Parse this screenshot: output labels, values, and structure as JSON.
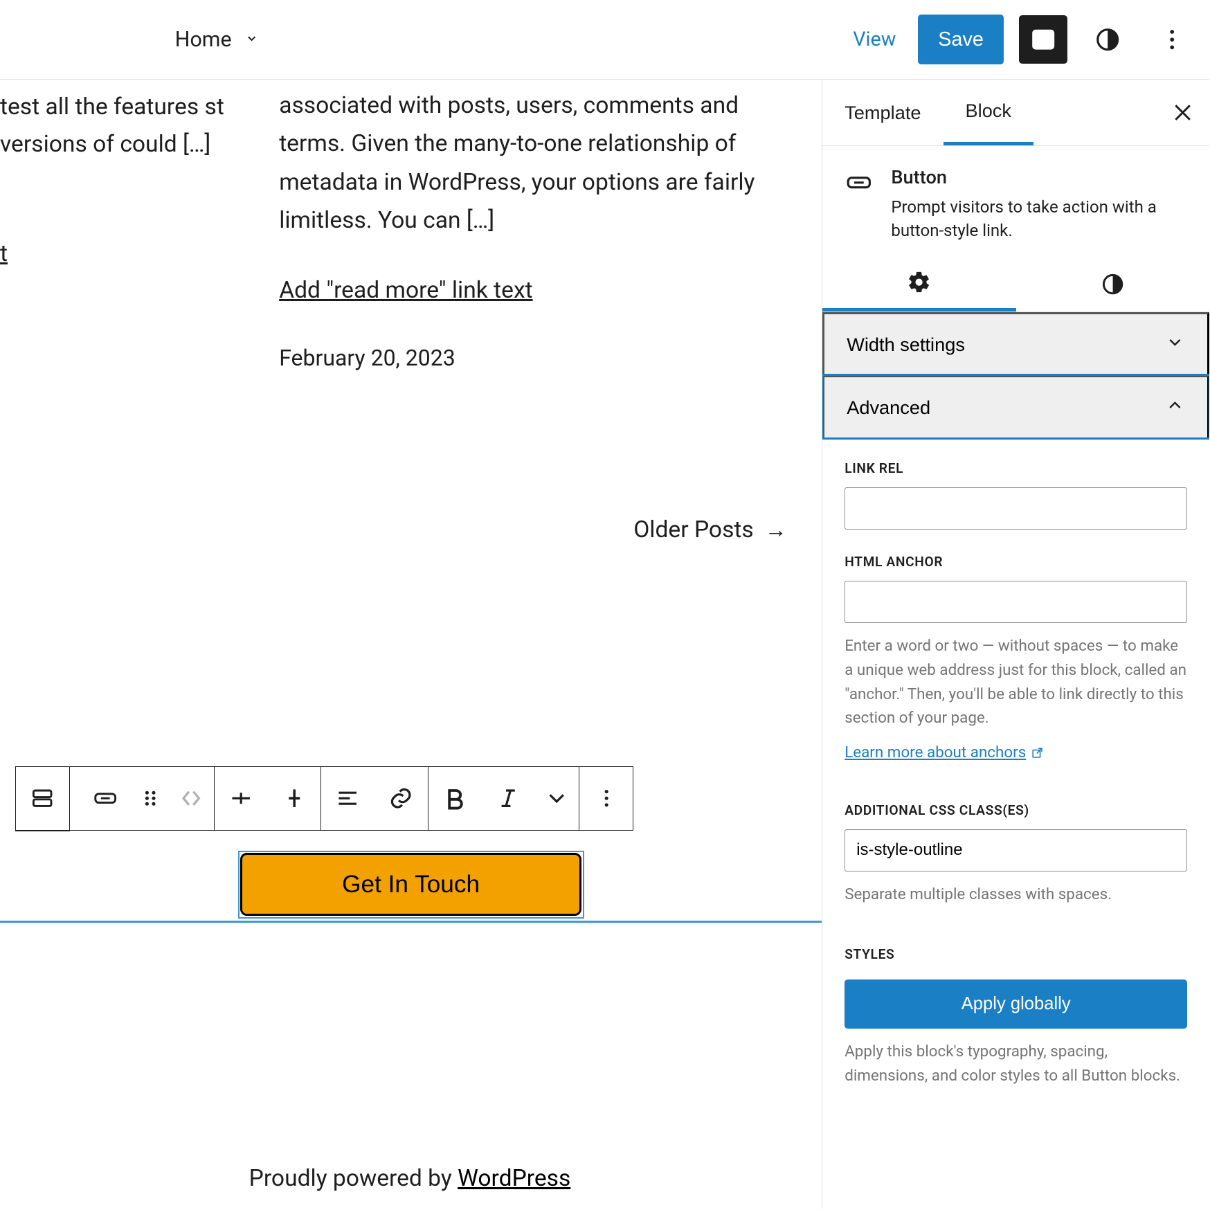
{
  "topbar": {
    "home": "Home",
    "view": "View",
    "save": "Save"
  },
  "canvas": {
    "excerpt_left": "test all the features st versions of could […]",
    "readmore_left": "t",
    "excerpt_right": "associated with posts, users, comments and terms. Given the many-to-one relationship of metadata in WordPress, your options are fairly limitless. You can […]",
    "readmore_right": "Add \"read more\" link text",
    "post_date": "February 20, 2023",
    "older_posts": "Older Posts",
    "button_label": "Get In Touch",
    "footer_prefix": "Proudly powered by ",
    "footer_link": "WordPress"
  },
  "sidebar": {
    "tabs": {
      "template": "Template",
      "block": "Block"
    },
    "block": {
      "name": "Button",
      "desc": "Prompt visitors to take action with a button-style link."
    },
    "panels": {
      "width": "Width settings",
      "advanced": "Advanced"
    },
    "fields": {
      "link_rel_label": "LINK REL",
      "link_rel_value": "",
      "anchor_label": "HTML ANCHOR",
      "anchor_value": "",
      "anchor_help": "Enter a word or two — without spaces — to make a unique web address just for this block, called an \"anchor.\" Then, you'll be able to link directly to this section of your page.",
      "anchor_learn": "Learn more about anchors",
      "css_label": "ADDITIONAL CSS CLASS(ES)",
      "css_value": "is-style-outline",
      "css_help": "Separate multiple classes with spaces.",
      "styles_label": "STYLES",
      "apply_globally": "Apply globally",
      "apply_help": "Apply this block's typography, spacing, dimensions, and color styles to all Button blocks."
    }
  },
  "icons": {
    "chevron_down": "chevron-down-icon",
    "chevron_up": "chevron-up-icon",
    "sidebar_toggle": "sidebar-toggle-icon",
    "contrast": "contrast-icon",
    "more": "more-vertical-icon",
    "close": "close-icon",
    "gear": "gear-icon",
    "button": "button-block-icon",
    "bold": "bold-icon",
    "italic": "italic-icon",
    "link": "link-icon",
    "align": "align-icon",
    "drag": "drag-icon",
    "plus": "add-before-icon",
    "plusv": "add-after-icon",
    "block_type": "block-type-icon",
    "prevnext": "prev-next-icon",
    "external": "external-link-icon"
  }
}
